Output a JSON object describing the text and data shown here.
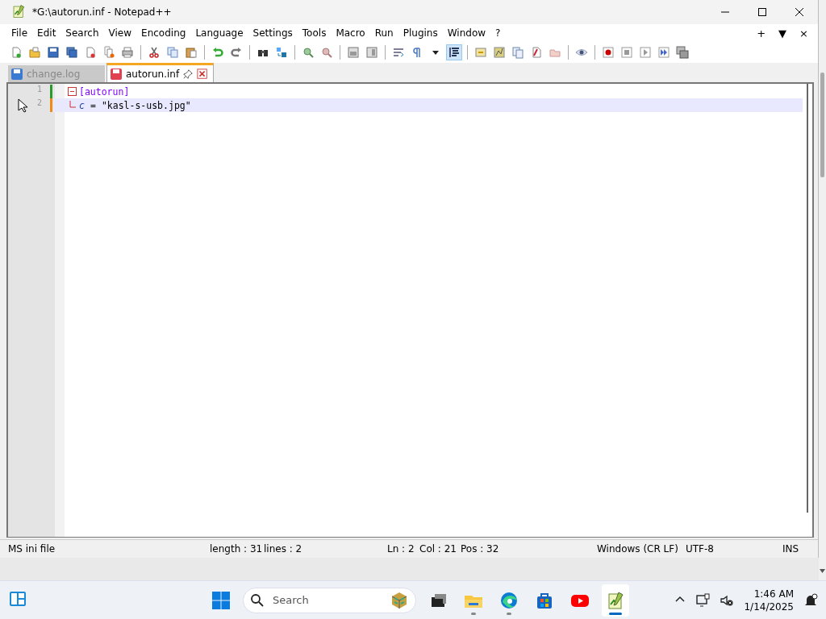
{
  "window": {
    "title": "*G:\\autorun.inf - Notepad++"
  },
  "menu": [
    "File",
    "Edit",
    "Search",
    "View",
    "Encoding",
    "Language",
    "Settings",
    "Tools",
    "Macro",
    "Run",
    "Plugins",
    "Window",
    "?"
  ],
  "menu_right": [
    "+",
    "▼",
    "×"
  ],
  "toolbar": [
    {
      "kind": "new",
      "pressed": false
    },
    {
      "kind": "open",
      "pressed": false
    },
    {
      "kind": "save",
      "pressed": false
    },
    {
      "kind": "save-all",
      "pressed": false
    },
    {
      "kind": "close",
      "pressed": false
    },
    {
      "kind": "close-all",
      "pressed": false
    },
    {
      "kind": "print",
      "pressed": false
    },
    {
      "kind": "sep"
    },
    {
      "kind": "cut",
      "pressed": false
    },
    {
      "kind": "copy",
      "pressed": false
    },
    {
      "kind": "paste",
      "pressed": false
    },
    {
      "kind": "sep"
    },
    {
      "kind": "undo",
      "pressed": false
    },
    {
      "kind": "redo",
      "pressed": false
    },
    {
      "kind": "sep"
    },
    {
      "kind": "find",
      "pressed": false
    },
    {
      "kind": "replace",
      "pressed": false
    },
    {
      "kind": "sep"
    },
    {
      "kind": "zoom-in",
      "pressed": false
    },
    {
      "kind": "zoom-out",
      "pressed": false
    },
    {
      "kind": "sep"
    },
    {
      "kind": "sync-v",
      "pressed": false
    },
    {
      "kind": "sync-h",
      "pressed": false
    },
    {
      "kind": "sep"
    },
    {
      "kind": "wrap",
      "pressed": false
    },
    {
      "kind": "pilcrow",
      "pressed": false
    },
    {
      "kind": "dropdown",
      "pressed": false
    },
    {
      "kind": "indent",
      "pressed": true
    },
    {
      "kind": "sep"
    },
    {
      "kind": "panel",
      "pressed": false
    },
    {
      "kind": "chart",
      "pressed": false
    },
    {
      "kind": "pages",
      "pressed": false
    },
    {
      "kind": "function",
      "pressed": false
    },
    {
      "kind": "folder",
      "pressed": false
    },
    {
      "kind": "sep"
    },
    {
      "kind": "eye",
      "pressed": false
    },
    {
      "kind": "sep"
    },
    {
      "kind": "record",
      "pressed": false
    },
    {
      "kind": "stop",
      "pressed": false
    },
    {
      "kind": "play",
      "pressed": false
    },
    {
      "kind": "play-multi",
      "pressed": false
    },
    {
      "kind": "save-macro",
      "pressed": false
    }
  ],
  "tabs": [
    {
      "label": "change.log",
      "selected": false
    },
    {
      "label": "autorun.inf",
      "selected": true
    }
  ],
  "editor": {
    "lines": [
      {
        "number": "1",
        "kind": "section",
        "text": "[autorun]",
        "current": false,
        "color": "#2a9a2a"
      },
      {
        "number": "2",
        "kind": "entry",
        "key": "c",
        "operator": "=",
        "value": "\"kasl-s-usb.jpg\"",
        "current": true,
        "color": "#f08a1a"
      }
    ]
  },
  "status_bar": [
    "MS ini file",
    "length : 31",
    "lines : 2",
    "Ln : 2",
    "Col : 21",
    "Pos : 32",
    "Windows (CR LF)",
    "UTF-8",
    "INS"
  ],
  "taskbar": {
    "search": {
      "placeholder": "Search"
    },
    "apps": [
      {
        "kind": "task-view",
        "running": false,
        "active": false
      },
      {
        "kind": "explorer",
        "running": true,
        "active": false
      },
      {
        "kind": "edge",
        "running": true,
        "active": false
      },
      {
        "kind": "store",
        "running": false,
        "active": false
      },
      {
        "kind": "youtube",
        "running": false,
        "active": false
      },
      {
        "kind": "notepad",
        "running": true,
        "active": true
      }
    ],
    "clock": {
      "time": "1:46 AM",
      "date": "1/14/2025"
    }
  }
}
